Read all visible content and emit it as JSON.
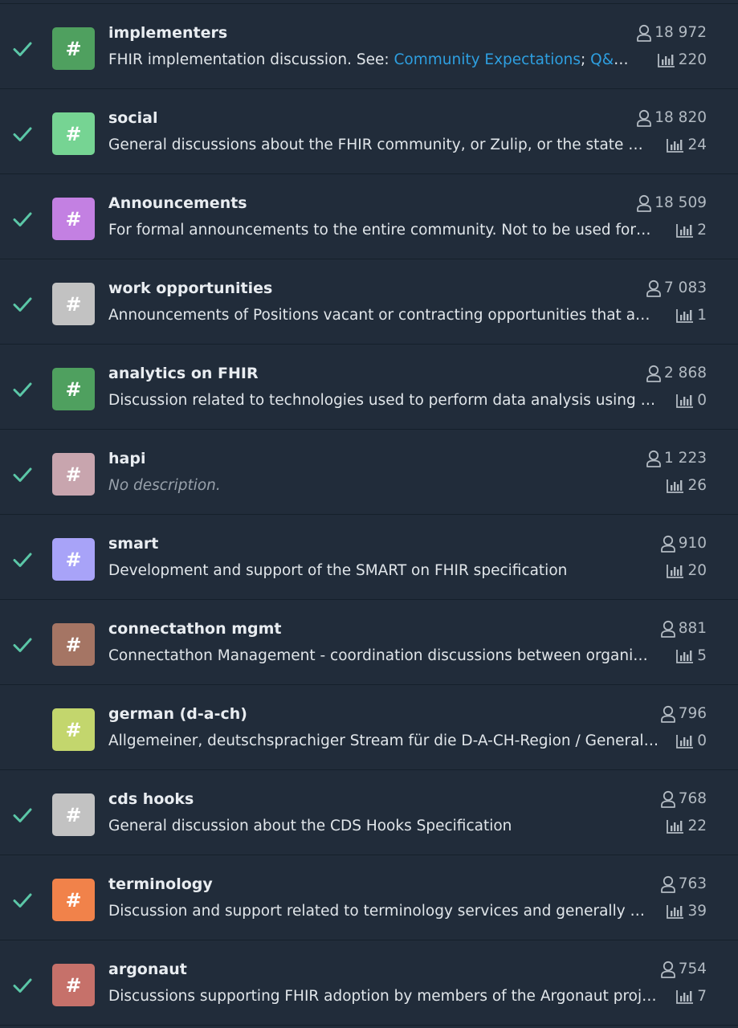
{
  "colors": {
    "background": "#212c3a",
    "check": "#5bc7a7",
    "link": "#2e9fe0"
  },
  "icons": {
    "subscribed": "check-icon",
    "subscribers": "user-outline-icon",
    "traffic": "bar-chart-icon",
    "stream": "hash-icon"
  },
  "streams": [
    {
      "name": "implementers",
      "color": "#4fa05f",
      "subscribed": true,
      "desc_prefix": "FHIR implementation discussion. See: ",
      "desc_link1": "Community Expectations",
      "desc_sep": "; ",
      "desc_link2": "Q&A G…",
      "subscribers": "18 972",
      "traffic": "220"
    },
    {
      "name": "social",
      "color": "#76d493",
      "subscribed": true,
      "description": "General discussions about the FHIR community, or Zulip, or the state of t…",
      "subscribers": "18 820",
      "traffic": "24"
    },
    {
      "name": "Announcements",
      "color": "#c380e2",
      "subscribed": true,
      "description": "For formal announcements to the entire community.  Not to be used for di…",
      "subscribers": "18 509",
      "traffic": "2"
    },
    {
      "name": "work opportunities",
      "color": "#c2c2c2",
      "subscribed": true,
      "description": "Announcements of Positions vacant or contracting opportunities that are …",
      "subscribers": "7 083",
      "traffic": "1"
    },
    {
      "name": "analytics on FHIR",
      "color": "#4fa05f",
      "subscribed": true,
      "description": "Discussion related to technologies used to perform data analysis using FHI…",
      "subscribers": "2 868",
      "traffic": "0"
    },
    {
      "name": "hapi",
      "color": "#c8a5ae",
      "subscribed": true,
      "description": "No description.",
      "italic": true,
      "subscribers": "1 223",
      "traffic": "26"
    },
    {
      "name": "smart",
      "color": "#a8a3f8",
      "subscribed": true,
      "description": "Development and support of the SMART on FHIR specification",
      "subscribers": "910",
      "traffic": "20"
    },
    {
      "name": "connectathon mgmt",
      "color": "#a57564",
      "subscribed": true,
      "description": "Connectathon Management - coordination discussions between organizer…",
      "subscribers": "881",
      "traffic": "5"
    },
    {
      "name": "german (d-a-ch)",
      "color": "#c3d66d",
      "subscribed": false,
      "description": "Allgemeiner, deutschsprachiger Stream für die D-A-CH-Region / General Ge…",
      "subscribers": "796",
      "traffic": "0"
    },
    {
      "name": "cds hooks",
      "color": "#c2c2c2",
      "subscribed": true,
      "description": "General discussion about the CDS Hooks Specification",
      "subscribers": "768",
      "traffic": "22"
    },
    {
      "name": "terminology",
      "color": "#f1824a",
      "subscribed": true,
      "description": "Discussion and support related to terminology services and generally ma…",
      "subscribers": "763",
      "traffic": "39"
    },
    {
      "name": "argonaut",
      "color": "#c6716a",
      "subscribed": true,
      "description": "Discussions supporting FHIR adoption  by members of the Argonaut project",
      "subscribers": "754",
      "traffic": "7"
    }
  ]
}
